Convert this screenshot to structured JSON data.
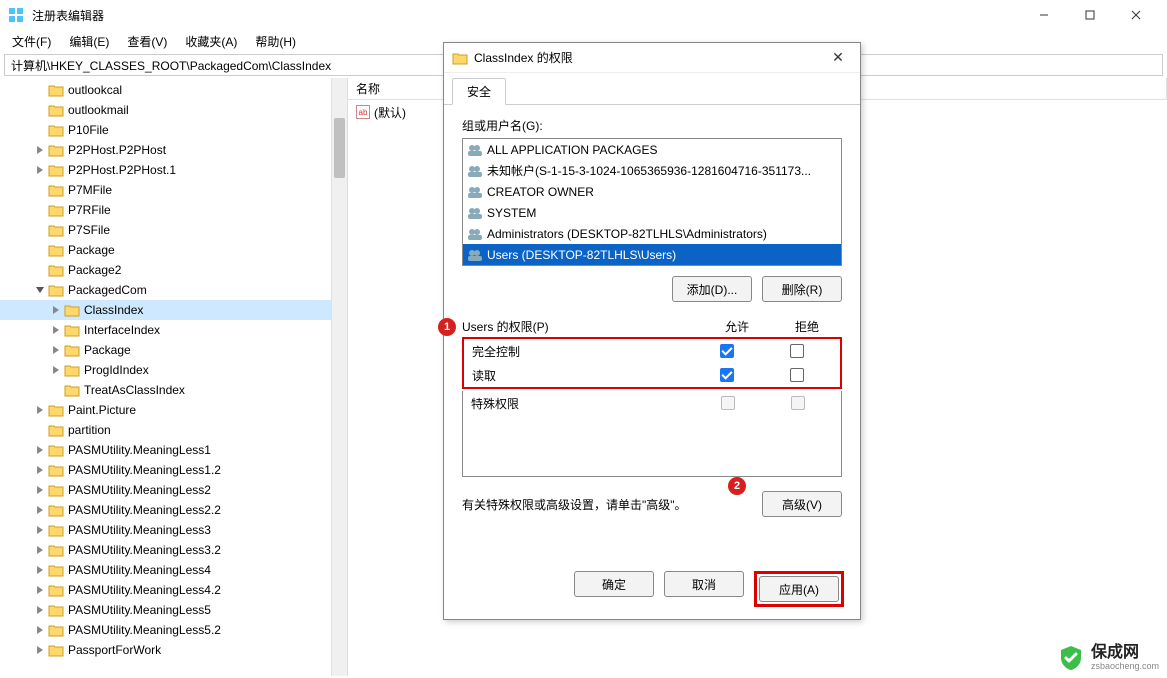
{
  "window": {
    "title": "注册表编辑器",
    "min": "—",
    "max": "☐",
    "close": "✕"
  },
  "menu": {
    "file": "文件(F)",
    "edit": "编辑(E)",
    "view": "查看(V)",
    "favorites": "收藏夹(A)",
    "help": "帮助(H)"
  },
  "address": "计算机\\HKEY_CLASSES_ROOT\\PackagedCom\\ClassIndex",
  "tree": [
    {
      "indent": 2,
      "exp": "",
      "label": "outlookcal"
    },
    {
      "indent": 2,
      "exp": "",
      "label": "outlookmail"
    },
    {
      "indent": 2,
      "exp": "",
      "label": "P10File"
    },
    {
      "indent": 2,
      "exp": ">",
      "label": "P2PHost.P2PHost"
    },
    {
      "indent": 2,
      "exp": ">",
      "label": "P2PHost.P2PHost.1"
    },
    {
      "indent": 2,
      "exp": "",
      "label": "P7MFile"
    },
    {
      "indent": 2,
      "exp": "",
      "label": "P7RFile"
    },
    {
      "indent": 2,
      "exp": "",
      "label": "P7SFile"
    },
    {
      "indent": 2,
      "exp": "",
      "label": "Package"
    },
    {
      "indent": 2,
      "exp": "",
      "label": "Package2"
    },
    {
      "indent": 2,
      "exp": "v",
      "label": "PackagedCom"
    },
    {
      "indent": 3,
      "exp": ">",
      "label": "ClassIndex",
      "selected": true
    },
    {
      "indent": 3,
      "exp": ">",
      "label": "InterfaceIndex"
    },
    {
      "indent": 3,
      "exp": ">",
      "label": "Package"
    },
    {
      "indent": 3,
      "exp": ">",
      "label": "ProgIdIndex"
    },
    {
      "indent": 3,
      "exp": "",
      "label": "TreatAsClassIndex"
    },
    {
      "indent": 2,
      "exp": ">",
      "label": "Paint.Picture"
    },
    {
      "indent": 2,
      "exp": "",
      "label": "partition"
    },
    {
      "indent": 2,
      "exp": ">",
      "label": "PASMUtility.MeaningLess1"
    },
    {
      "indent": 2,
      "exp": ">",
      "label": "PASMUtility.MeaningLess1.2"
    },
    {
      "indent": 2,
      "exp": ">",
      "label": "PASMUtility.MeaningLess2"
    },
    {
      "indent": 2,
      "exp": ">",
      "label": "PASMUtility.MeaningLess2.2"
    },
    {
      "indent": 2,
      "exp": ">",
      "label": "PASMUtility.MeaningLess3"
    },
    {
      "indent": 2,
      "exp": ">",
      "label": "PASMUtility.MeaningLess3.2"
    },
    {
      "indent": 2,
      "exp": ">",
      "label": "PASMUtility.MeaningLess4"
    },
    {
      "indent": 2,
      "exp": ">",
      "label": "PASMUtility.MeaningLess4.2"
    },
    {
      "indent": 2,
      "exp": ">",
      "label": "PASMUtility.MeaningLess5"
    },
    {
      "indent": 2,
      "exp": ">",
      "label": "PASMUtility.MeaningLess5.2"
    },
    {
      "indent": 2,
      "exp": ">",
      "label": "PassportForWork"
    }
  ],
  "list": {
    "header_name": "名称",
    "default_value": "(默认)",
    "ab": "ab"
  },
  "dialog": {
    "title": "ClassIndex 的权限",
    "tab_security": "安全",
    "group_users_label": "组或用户名(G):",
    "users": [
      "ALL APPLICATION PACKAGES",
      "未知帐户(S-1-15-3-1024-1065365936-1281604716-351173...",
      "CREATOR OWNER",
      "SYSTEM",
      "Administrators (DESKTOP-82TLHLS\\Administrators)",
      "Users (DESKTOP-82TLHLS\\Users)"
    ],
    "add_btn": "添加(D)...",
    "remove_btn": "删除(R)",
    "perm_label": "Users 的权限(P)",
    "allow": "允许",
    "deny": "拒绝",
    "perm_full": "完全控制",
    "perm_read": "读取",
    "perm_special": "特殊权限",
    "adv_text": "有关特殊权限或高级设置，请单击\"高级\"。",
    "adv_btn": "高级(V)",
    "ok": "确定",
    "cancel": "取消",
    "apply": "应用(A)",
    "badge1": "1",
    "badge2": "2"
  },
  "watermark": {
    "name": "保成网",
    "url": "zsbaocheng.com"
  }
}
